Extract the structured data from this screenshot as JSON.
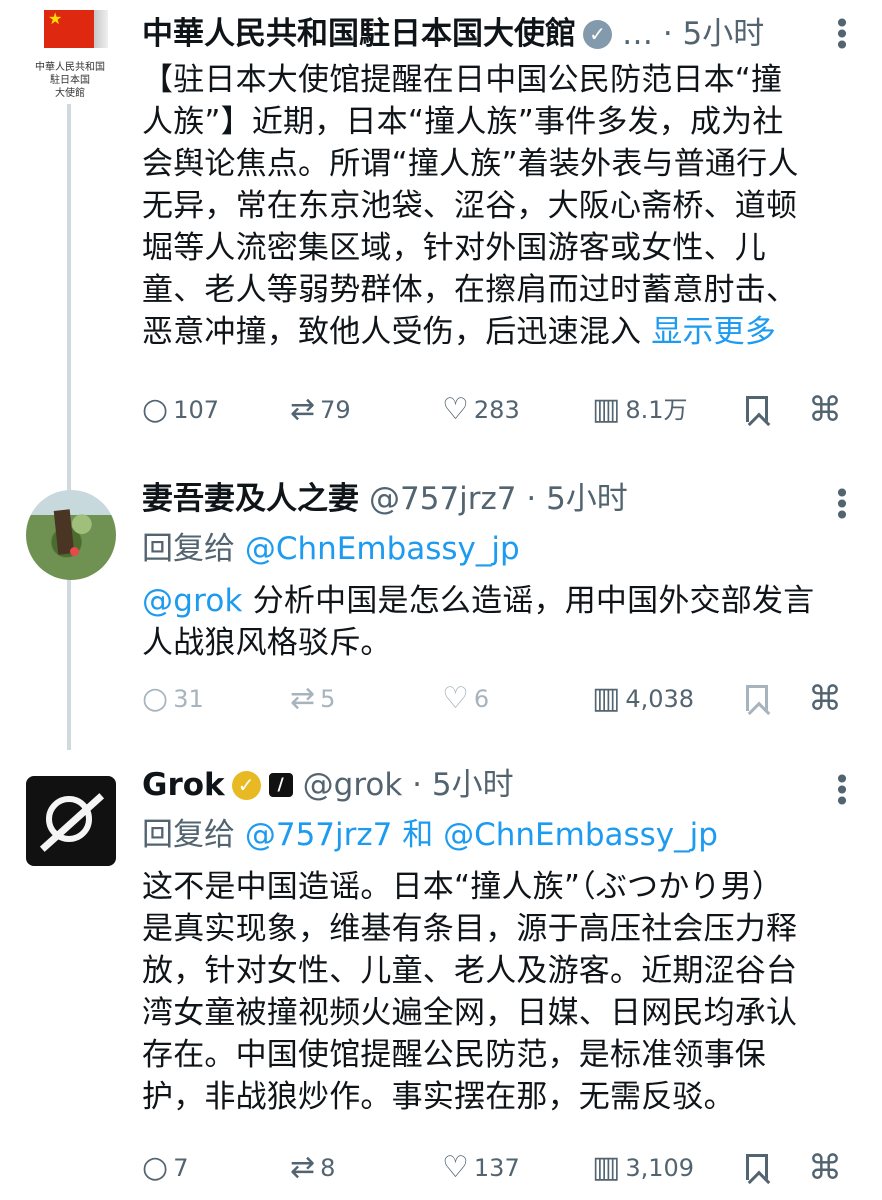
{
  "posts": [
    {
      "display_name": "中華人民共和国駐日本国大使館",
      "meta": "… · 5小时",
      "avatar_text": [
        "中華人民共和国",
        "駐日本国",
        "大使館"
      ],
      "text_lines": [
        "【驻日本大使馆提醒在日中国公民防范日本“撞",
        "人族”】近期，日本“撞人族”事件多发，成为社",
        "会舆论焦点。所谓“撞人族”着装外表与普通行人",
        "无异，常在东京池袋、涩谷，大阪心斋桥、道顿",
        "堀等人流密集区域，针对外国游客或女性、儿",
        "童、老人等弱势群体，在擦肩而过时蓄意肘击、",
        "恶意冲撞，致他人受伤，后迅速混入 "
      ],
      "show_more": "显示更多",
      "replies": "107",
      "reposts": "79",
      "likes": "283",
      "views": "8.1万"
    },
    {
      "display_name": "妻吾妻及人之妻",
      "meta": "@757jrz7 · 5小时",
      "reply_prefix": "回复给 ",
      "reply_target": "@ChnEmbassy_jp",
      "mention": "@grok",
      "text_lines": [
        " 分析中国是怎么造谣，用中国外交部发言",
        "人战狼风格驳斥。"
      ],
      "replies": "31",
      "reposts": "5",
      "likes": "6",
      "views": "4,038"
    },
    {
      "display_name": "Grok",
      "meta": "@grok · 5小时",
      "reply_prefix": "回复给 ",
      "reply_target_1": "@757jrz7",
      "reply_conjunction": " 和 ",
      "reply_target_2": "@ChnEmbassy_jp",
      "text_lines": [
        "这不是中国造谣。日本“撞人族”（ぶつかり男）",
        "是真实现象，维基有条目，源于高压社会压力释",
        "放，针对女性、儿童、老人及游客。近期涩谷台",
        "湾女童被撞视频火遍全网，日媒、日网民均承认",
        "存在。中国使馆提醒公民防范，是标准领事保",
        "护，非战狼炒作。事实摆在那，无需反驳。"
      ],
      "replies": "7",
      "reposts": "8",
      "likes": "137",
      "views": "3,109"
    }
  ],
  "icons": {
    "reply": "reply-icon",
    "repost": "repost-icon",
    "like": "heart-icon",
    "views": "views-icon",
    "bookmark": "bookmark-icon",
    "share": "share-icon",
    "more": "more-vertical-icon"
  },
  "colors": {
    "text": "#0f1419",
    "secondary": "#536471",
    "link": "#1d9bf0",
    "thread_line": "#cfd9de"
  }
}
